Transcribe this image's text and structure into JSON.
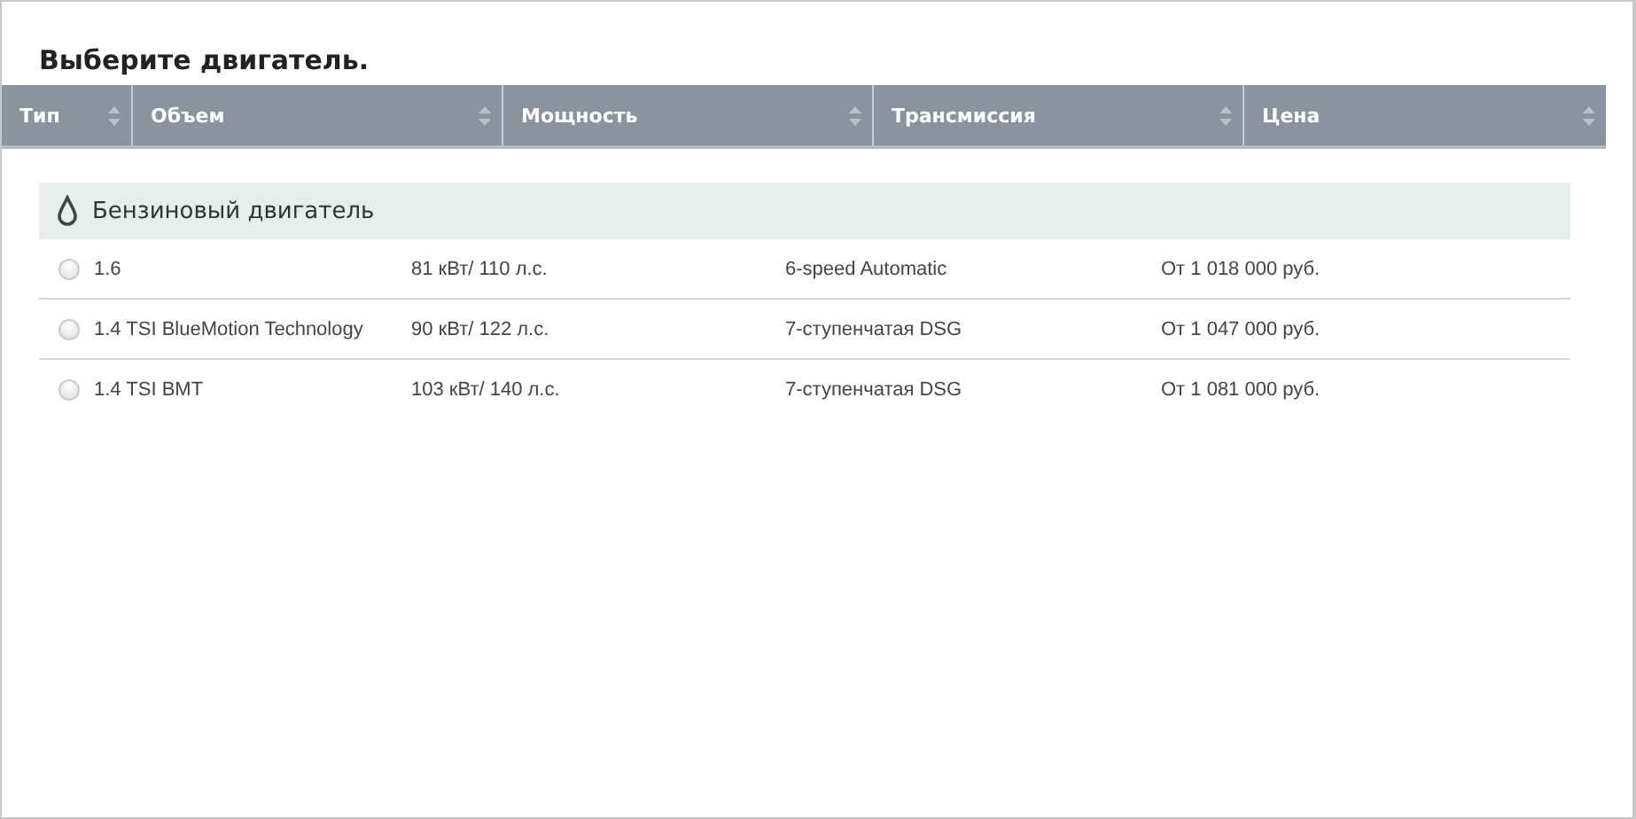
{
  "title": "Выберите двигатель.",
  "columns": [
    {
      "label": "Тип"
    },
    {
      "label": "Объем"
    },
    {
      "label": "Мощность"
    },
    {
      "label": "Трансмиссия"
    },
    {
      "label": "Цена"
    }
  ],
  "group": {
    "label": "Бензиновый двигатель"
  },
  "rows": [
    {
      "selected": false,
      "engine": "1.6",
      "power": "81 кВт/ 110 л.с.",
      "transmission": "6-speed Automatic",
      "price": "От 1 018 000 руб."
    },
    {
      "selected": false,
      "engine": "1.4 TSI BlueMotion Technology",
      "power": "90 кВт/ 122 л.с.",
      "transmission": "7-ступенчатая DSG",
      "price": "От 1 047 000 руб."
    },
    {
      "selected": false,
      "engine": "1.4 TSI BMT",
      "power": "103 кВт/ 140 л.с.",
      "transmission": "7-ступенчатая DSG",
      "price": "От 1 081 000 руб."
    }
  ]
}
